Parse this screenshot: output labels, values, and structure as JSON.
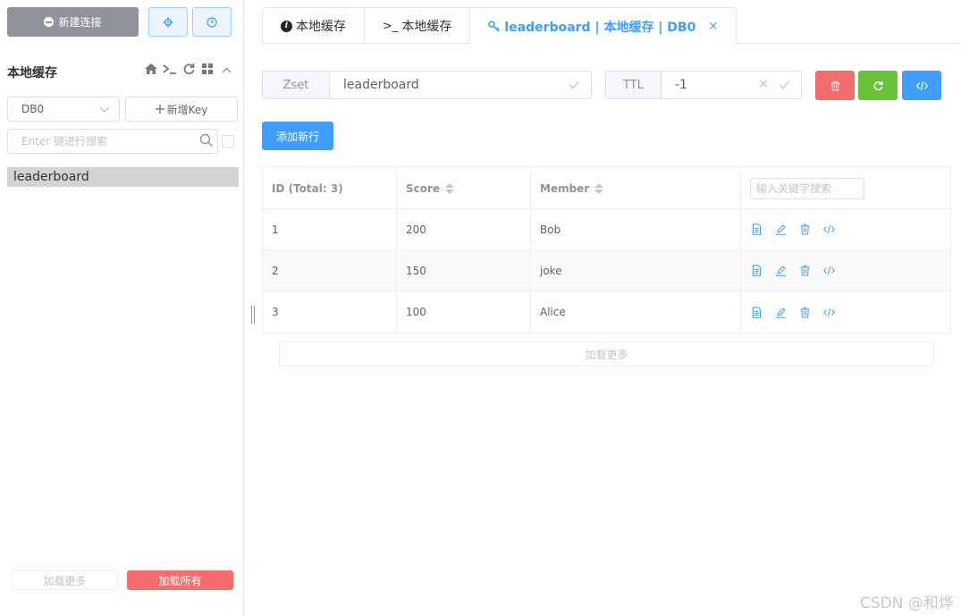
{
  "sidebar": {
    "new_connection_label": "新建连接",
    "connection_name": "本地缓存",
    "db_selected": "DB0",
    "add_key_label": "新增Key",
    "search_placeholder": "Enter 键进行搜索",
    "keys": [
      {
        "name": "leaderboard"
      }
    ],
    "load_more_label": "加载更多",
    "load_all_label": "加载所有"
  },
  "tabs": [
    {
      "label": "本地缓存",
      "icon": "info-icon"
    },
    {
      "label": "本地缓存",
      "icon": "terminal-icon"
    },
    {
      "label": "leaderboard | 本地缓存 | DB0",
      "icon": "key-icon",
      "active": true
    }
  ],
  "key_info": {
    "type_label": "Zset",
    "key_name": "leaderboard",
    "ttl_label": "TTL",
    "ttl_value": "-1"
  },
  "add_row_label": "添加新行",
  "table": {
    "columns": [
      "ID (Total: 3)",
      "Score",
      "Member"
    ],
    "search_placeholder": "输入关键字搜索",
    "rows": [
      {
        "id": "1",
        "score": "200",
        "member": "Bob"
      },
      {
        "id": "2",
        "score": "150",
        "member": "joke"
      },
      {
        "id": "3",
        "score": "100",
        "member": "Alice"
      }
    ],
    "load_more_label": "加载更多"
  },
  "watermark": "CSDN @和烨",
  "colors": {
    "primary": "#409eff",
    "danger": "#f56c6c",
    "success": "#67c23a",
    "info": "#909399"
  }
}
